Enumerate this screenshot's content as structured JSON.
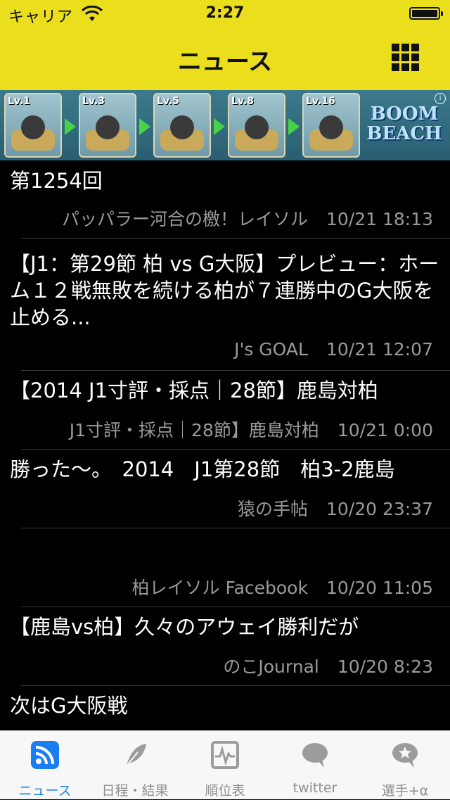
{
  "status_bar": {
    "carrier": "キャリア",
    "time": "2:27"
  },
  "nav": {
    "title": "ニュース",
    "menu_icon": "grid-menu-icon"
  },
  "ad": {
    "levels": [
      "Lv.1",
      "Lv.3",
      "Lv.5",
      "Lv.8",
      "Lv.16"
    ],
    "brand_line1": "BOOM",
    "brand_line2": "BEACH",
    "info": "i"
  },
  "news": [
    {
      "title": "第1254回",
      "source": "パッパラー河合の檄！レイソル",
      "date": "10/21 18:13"
    },
    {
      "title": "【J1：第29節 柏 vs G大阪】プレビュー：ホーム１２戦無敗を続ける柏が７連勝中のG大阪を止める...",
      "source": "J's GOAL",
      "date": "10/21 12:07"
    },
    {
      "title": "【2014 J1寸評・採点｜28節】鹿島対柏",
      "source": "J1寸評・採点｜28節】鹿島対柏",
      "date": "10/21 0:00"
    },
    {
      "title": "勝った〜。　2014　J1第28節　柏3-2鹿島",
      "source": "猿の手帖",
      "date": "10/20 23:37"
    },
    {
      "title": "",
      "source": "柏レイソル Facebook",
      "date": "10/20 11:05"
    },
    {
      "title": "【鹿島vs柏】久々のアウェイ勝利だが",
      "source": "のこJournal",
      "date": "10/20 8:23"
    },
    {
      "title": "次はG大阪戦",
      "source": "",
      "date": ""
    }
  ],
  "tabs": [
    {
      "label": "ニュース",
      "icon": "rss-icon",
      "active": true
    },
    {
      "label": "日程・結果",
      "icon": "feather-icon",
      "active": false
    },
    {
      "label": "順位表",
      "icon": "pulse-monitor-icon",
      "active": false
    },
    {
      "label": "twitter",
      "icon": "speech-bubble-icon",
      "active": false
    },
    {
      "label": "選手+α",
      "icon": "star-bubble-icon",
      "active": false
    }
  ],
  "colors": {
    "header": "#ebde1c",
    "active_tab": "#1a7ef2",
    "inactive_tab": "#8e8e8e",
    "background": "#000000"
  }
}
